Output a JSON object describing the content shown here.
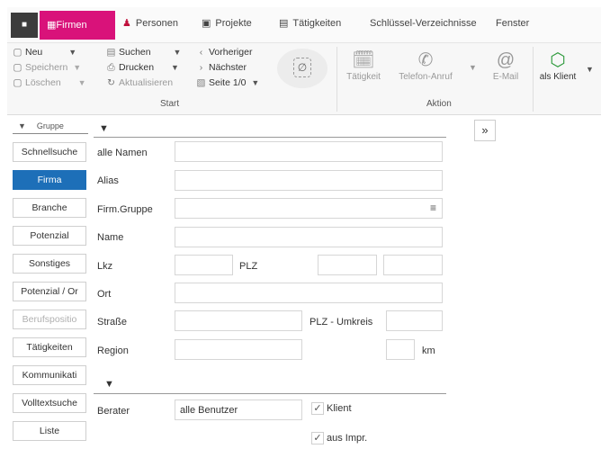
{
  "menu": {
    "app_label": "■",
    "items": [
      "Firmen",
      "Personen",
      "Projekte",
      "Tätigkeiten",
      "Schlüssel-Verzeichnisse",
      "Fenster"
    ]
  },
  "ribbon": {
    "neu": "Neu",
    "speichern": "Speichern",
    "loeschen": "Löschen",
    "suchen": "Suchen",
    "drucken": "Drucken",
    "aktualisieren": "Aktualisieren",
    "vorheriger": "Vorheriger",
    "naechster": "Nächster",
    "seite": "Seite 1/0",
    "group_start": "Start",
    "taetigkeit": "Tätigkeit",
    "telefon": "Telefon-Anruf",
    "email": "E-Mail",
    "als_klient": "als Klient",
    "group_aktion": "Aktion"
  },
  "sidebar": {
    "header": "Gruppe",
    "items": [
      "Schnellsuche",
      "Firma",
      "Branche",
      "Potenzial",
      "Sonstiges",
      "Potenzial / Or",
      "Berufspositio",
      "Tätigkeiten",
      "Kommunikati",
      "Volltextsuche",
      "Liste"
    ],
    "active_index": 1
  },
  "form": {
    "labels": {
      "alle_namen": "alle Namen",
      "alias": "Alias",
      "firm_gruppe": "Firm.Gruppe",
      "name": "Name",
      "lkz": "Lkz",
      "plz": "PLZ",
      "ort": "Ort",
      "strasse": "Straße",
      "plz_umkreis": "PLZ - Umkreis",
      "region": "Region",
      "km": "km",
      "berater": "Berater"
    },
    "berater_value": "alle Benutzer",
    "klient_label": "Klient",
    "klient_checked": true,
    "aus_impr_label": "aus Impr.",
    "aus_impr_checked": true
  },
  "colors": {
    "accent": "#d9127a",
    "active": "#1d6fb8"
  }
}
